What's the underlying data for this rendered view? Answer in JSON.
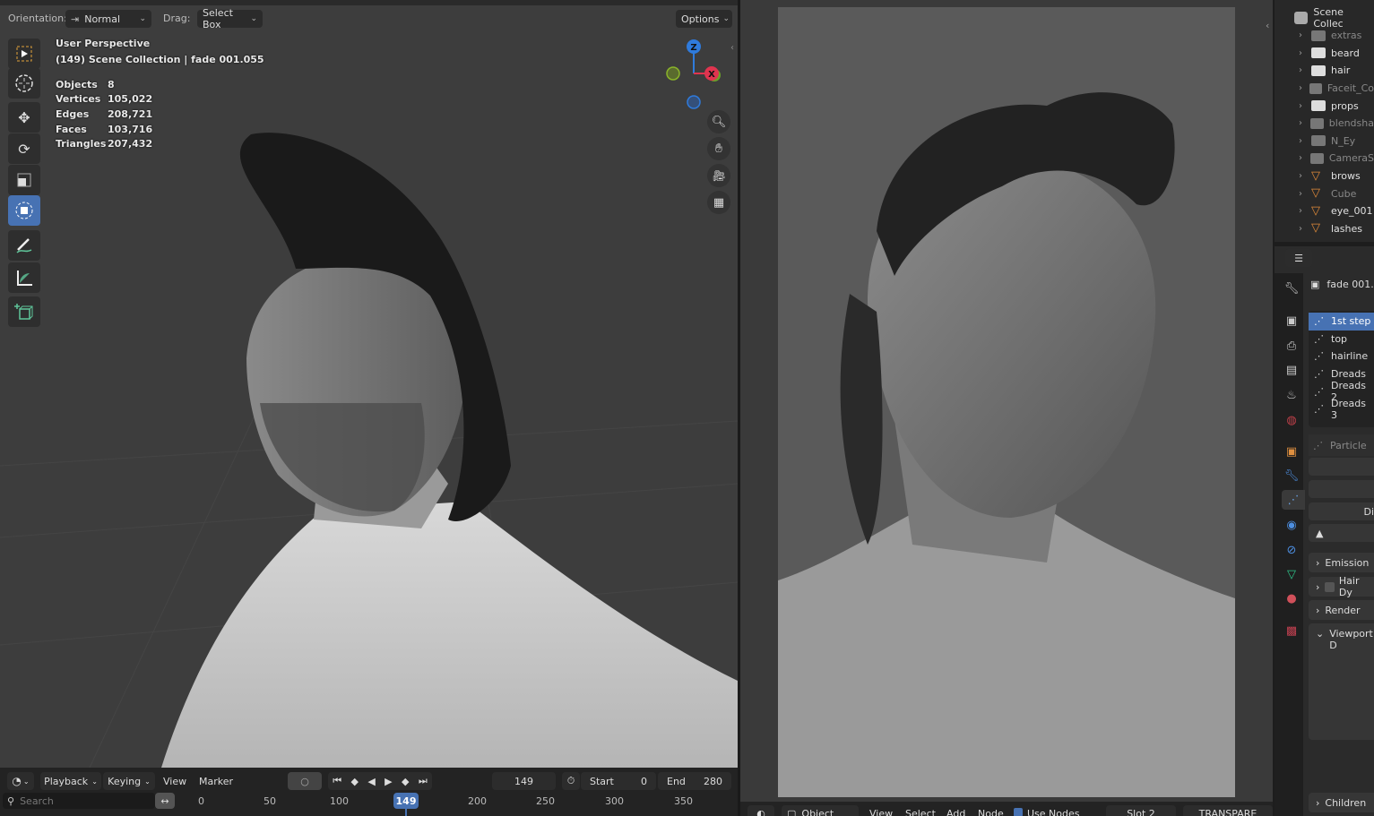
{
  "left_viewport": {
    "header": {
      "orientation_label": "Orientation:",
      "orientation_value": "Normal",
      "drag_label": "Drag:",
      "drag_value": "Select Box",
      "options_label": "Options"
    },
    "overlay": {
      "view_name": "User Perspective",
      "context": "(149) Scene Collection | fade 001.055",
      "stats": [
        {
          "k": "Objects",
          "v": "8"
        },
        {
          "k": "Vertices",
          "v": "105,022"
        },
        {
          "k": "Edges",
          "v": "208,721"
        },
        {
          "k": "Faces",
          "v": "103,716"
        },
        {
          "k": "Triangles",
          "v": "207,432"
        }
      ]
    },
    "gizmo": {
      "z": "Z",
      "x": "X",
      "z_color": "#2f7bdc",
      "x_color": "#e0344f",
      "y_color": "#8ab42a"
    },
    "tools": [
      "select-box",
      "cursor",
      "move",
      "rotate",
      "scale",
      "transform",
      "annotate",
      "measure",
      "add-cube"
    ],
    "active_tool": "transform"
  },
  "timeline": {
    "menu": {
      "playback": "Playback",
      "keying": "Keying",
      "view": "View",
      "marker": "Marker"
    },
    "current_frame": "149",
    "start_label": "Start",
    "start_value": "0",
    "end_label": "End",
    "end_value": "280",
    "search_placeholder": "Search",
    "ticks": [
      "0",
      "50",
      "100",
      "149",
      "200",
      "250",
      "300",
      "350"
    ]
  },
  "node_header": {
    "mode": "Object",
    "view": "View",
    "select": "Select",
    "add": "Add",
    "node": "Node",
    "use_nodes": "Use Nodes",
    "slot": "Slot 2",
    "blend": "TRANSPARE"
  },
  "outliner": {
    "root": "Scene Collec",
    "items": [
      {
        "label": "extras",
        "type": "collection",
        "dim": true
      },
      {
        "label": "beard",
        "type": "collection",
        "dim": false
      },
      {
        "label": "hair",
        "type": "collection",
        "dim": false
      },
      {
        "label": "Faceit_Co",
        "type": "collection",
        "dim": true
      },
      {
        "label": "props",
        "type": "collection",
        "dim": false
      },
      {
        "label": "blendsha",
        "type": "collection",
        "dim": true
      },
      {
        "label": "N_Ey",
        "type": "collection",
        "dim": true
      },
      {
        "label": "CameraS",
        "type": "collection",
        "dim": true
      },
      {
        "label": "brows",
        "type": "mesh",
        "dim": false
      },
      {
        "label": "Cube",
        "type": "mesh",
        "dim": true
      },
      {
        "label": "eye_001",
        "type": "mesh",
        "dim": false
      },
      {
        "label": "lashes",
        "type": "mesh",
        "dim": false
      }
    ]
  },
  "properties": {
    "object_name": "fade 001.",
    "particle_systems": [
      "1st step",
      "top",
      "hairline",
      "Dreads",
      "Dreads 2",
      "Dreads 3"
    ],
    "selected": "1st step",
    "particle_field": "Particle",
    "btn_di": "Di",
    "panels": [
      "Emission",
      "Hair Dy",
      "Render",
      "Viewport D"
    ],
    "children": "Children"
  }
}
